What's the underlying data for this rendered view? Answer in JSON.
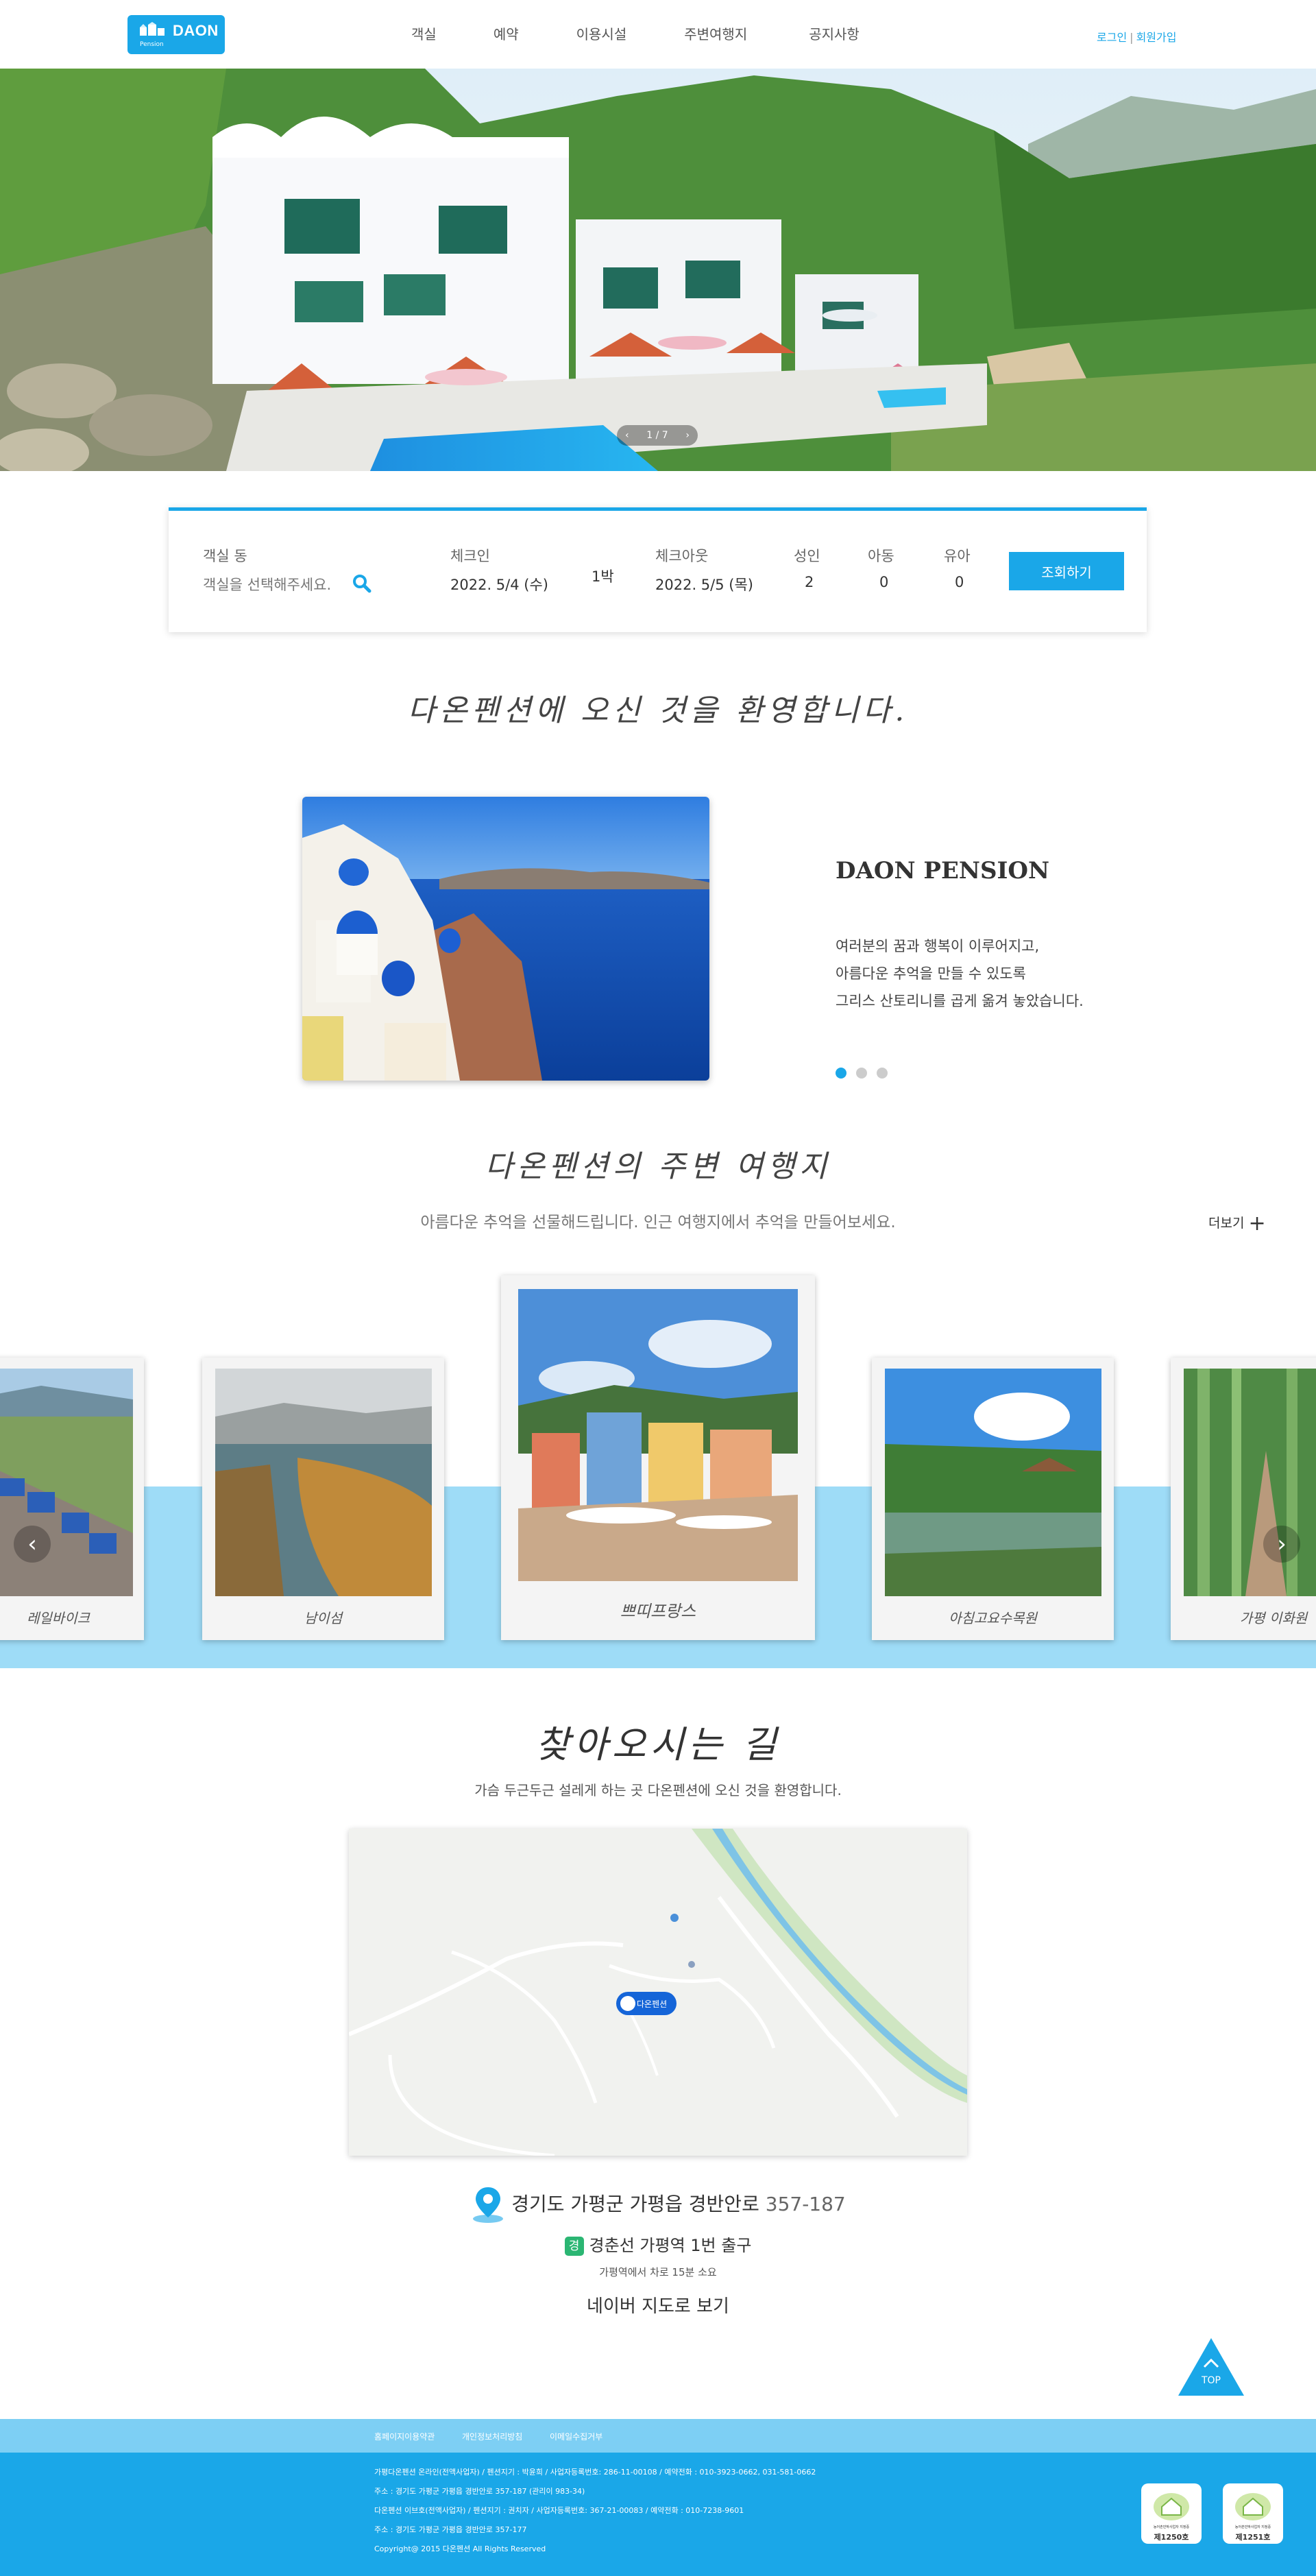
{
  "header": {
    "logo_text": "DAON",
    "logo_sub": "Pension",
    "nav": [
      "객실",
      "예약",
      "이용시설",
      "주변여행지",
      "공지사항"
    ],
    "login": "로그인",
    "join": "회원가입"
  },
  "hero": {
    "counter": "1 / 7",
    "prev": "‹",
    "next": "›"
  },
  "booking": {
    "room_label": "객실 동",
    "room_placeholder": "객실을 선택해주세요.",
    "checkin_label": "체크인",
    "checkin_value": "2022. 5/4 (수)",
    "nights": "1박",
    "checkout_label": "체크아웃",
    "checkout_value": "2022. 5/5 (목)",
    "adult_label": "성인",
    "adult_value": "2",
    "child_label": "아동",
    "child_value": "0",
    "infant_label": "유아",
    "infant_value": "0",
    "search_button": "조회하기"
  },
  "welcome": {
    "title": "다온펜션에 오신 것을 환영합니다.",
    "heading": "DAON PENSION",
    "desc": [
      "여러분의 꿈과 행복이 이루어지고,",
      "아름다운 추억을 만들 수 있도록",
      "그리스 산토리니를 곱게 옮겨 놓았습니다."
    ]
  },
  "tour": {
    "title": "다온펜션의 주변 여행지",
    "subtitle": "아름다운 추억을 선물해드립니다. 인근 여행지에서 추억을 만들어보세요.",
    "more": "더보기",
    "cards": [
      "레일바이크",
      "남이섬",
      "쁘띠프랑스",
      "아침고요수목원",
      "가평 이화원"
    ]
  },
  "map_section": {
    "title": "찾아오시는 길",
    "subtitle": "가슴 두근두근 설레게 하는 곳 다온펜션에 오신 것을 환영합니다.",
    "map_label": "다온펜션",
    "address": "경기도 가평군 가평읍 경반안로",
    "address_num": "357-187",
    "station_badge": "경",
    "station": "경춘선 가평역 1번 출구",
    "walk": "가평역에서 차로 15분 소요",
    "naver": "네이버 지도로 보기",
    "top": "TOP"
  },
  "footer": {
    "links": [
      "홈페이지이용약관",
      "개인정보처리방침",
      "이메일수집거부"
    ],
    "lines": [
      "가평다온펜션 온라인(전액사업자) / 펜션지기 : 박윤희 / 사업자등록번호: 286-11-00108 / 예약전화 : 010-3923-0662, 031-581-0662",
      "주소 : 경기도 가평군 가평읍 경반안로 357-187 (관리이 983-34)",
      "다온펜션 이브호(전액사업자) / 펜션지기 : 권치자 / 사업자등록번호: 367-21-00083 / 예약전화 : 010-7238-9601",
      "주소 : 경기도 가평군 가평읍 경반안로 357-177",
      "Copyright@ 2015 다온펜션 All Rights Reserved"
    ],
    "cert1": "제1250호",
    "cert2": "제1251호",
    "cert_caption": "농어촌민박사업자 지정증"
  }
}
